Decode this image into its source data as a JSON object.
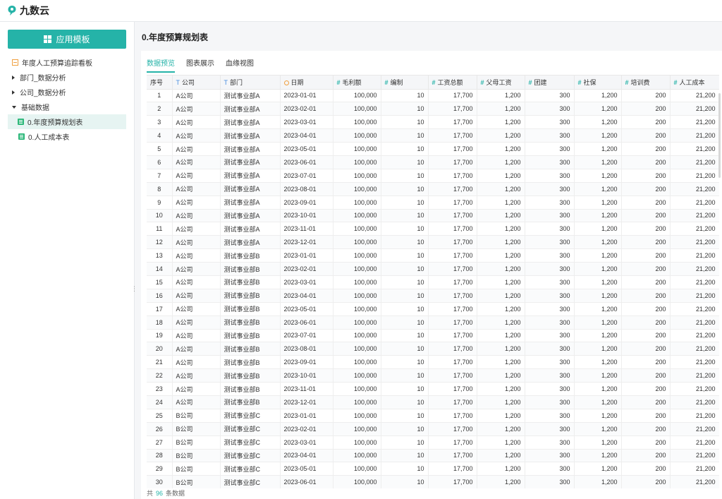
{
  "app": {
    "name": "九数云",
    "logo_icon": "jiushuyun-logo-icon"
  },
  "sidebar": {
    "template_button": "应用模板",
    "tree": [
      {
        "label": "年度人工预算追踪看板",
        "icon": "dashboard-icon",
        "level": 0
      },
      {
        "label": "部门_数据分析",
        "icon": "caret-right-icon",
        "level": 0
      },
      {
        "label": "公司_数据分析",
        "icon": "caret-right-icon",
        "level": 0
      },
      {
        "label": "基础数据",
        "icon": "caret-down-icon",
        "level": 0
      },
      {
        "label": "0.年度预算规划表",
        "icon": "table-icon",
        "level": 1,
        "selected": true
      },
      {
        "label": "0.人工成本表",
        "icon": "table-icon",
        "level": 1
      }
    ]
  },
  "main": {
    "title": "0.年度预算规划表",
    "tabs": [
      "数据预览",
      "图表展示",
      "血缘视图"
    ],
    "active_tab": 0
  },
  "table": {
    "columns": [
      {
        "label": "序号",
        "type": "index"
      },
      {
        "label": "公司",
        "type": "text"
      },
      {
        "label": "部门",
        "type": "text"
      },
      {
        "label": "日期",
        "type": "date"
      },
      {
        "label": "毛利额",
        "type": "number"
      },
      {
        "label": "编制",
        "type": "number"
      },
      {
        "label": "工资总额",
        "type": "number"
      },
      {
        "label": "父母工资",
        "type": "number"
      },
      {
        "label": "团建",
        "type": "number"
      },
      {
        "label": "社保",
        "type": "number"
      },
      {
        "label": "培训费",
        "type": "number"
      },
      {
        "label": "人工成本",
        "type": "number"
      }
    ],
    "rows": [
      [
        "1",
        "A公司",
        "测试事业部A",
        "2023-01-01",
        "100,000",
        "10",
        "17,700",
        "1,200",
        "300",
        "1,200",
        "200",
        "21,200"
      ],
      [
        "2",
        "A公司",
        "测试事业部A",
        "2023-02-01",
        "100,000",
        "10",
        "17,700",
        "1,200",
        "300",
        "1,200",
        "200",
        "21,200"
      ],
      [
        "3",
        "A公司",
        "测试事业部A",
        "2023-03-01",
        "100,000",
        "10",
        "17,700",
        "1,200",
        "300",
        "1,200",
        "200",
        "21,200"
      ],
      [
        "4",
        "A公司",
        "测试事业部A",
        "2023-04-01",
        "100,000",
        "10",
        "17,700",
        "1,200",
        "300",
        "1,200",
        "200",
        "21,200"
      ],
      [
        "5",
        "A公司",
        "测试事业部A",
        "2023-05-01",
        "100,000",
        "10",
        "17,700",
        "1,200",
        "300",
        "1,200",
        "200",
        "21,200"
      ],
      [
        "6",
        "A公司",
        "测试事业部A",
        "2023-06-01",
        "100,000",
        "10",
        "17,700",
        "1,200",
        "300",
        "1,200",
        "200",
        "21,200"
      ],
      [
        "7",
        "A公司",
        "测试事业部A",
        "2023-07-01",
        "100,000",
        "10",
        "17,700",
        "1,200",
        "300",
        "1,200",
        "200",
        "21,200"
      ],
      [
        "8",
        "A公司",
        "测试事业部A",
        "2023-08-01",
        "100,000",
        "10",
        "17,700",
        "1,200",
        "300",
        "1,200",
        "200",
        "21,200"
      ],
      [
        "9",
        "A公司",
        "测试事业部A",
        "2023-09-01",
        "100,000",
        "10",
        "17,700",
        "1,200",
        "300",
        "1,200",
        "200",
        "21,200"
      ],
      [
        "10",
        "A公司",
        "测试事业部A",
        "2023-10-01",
        "100,000",
        "10",
        "17,700",
        "1,200",
        "300",
        "1,200",
        "200",
        "21,200"
      ],
      [
        "11",
        "A公司",
        "测试事业部A",
        "2023-11-01",
        "100,000",
        "10",
        "17,700",
        "1,200",
        "300",
        "1,200",
        "200",
        "21,200"
      ],
      [
        "12",
        "A公司",
        "测试事业部A",
        "2023-12-01",
        "100,000",
        "10",
        "17,700",
        "1,200",
        "300",
        "1,200",
        "200",
        "21,200"
      ],
      [
        "13",
        "A公司",
        "测试事业部B",
        "2023-01-01",
        "100,000",
        "10",
        "17,700",
        "1,200",
        "300",
        "1,200",
        "200",
        "21,200"
      ],
      [
        "14",
        "A公司",
        "测试事业部B",
        "2023-02-01",
        "100,000",
        "10",
        "17,700",
        "1,200",
        "300",
        "1,200",
        "200",
        "21,200"
      ],
      [
        "15",
        "A公司",
        "测试事业部B",
        "2023-03-01",
        "100,000",
        "10",
        "17,700",
        "1,200",
        "300",
        "1,200",
        "200",
        "21,200"
      ],
      [
        "16",
        "A公司",
        "测试事业部B",
        "2023-04-01",
        "100,000",
        "10",
        "17,700",
        "1,200",
        "300",
        "1,200",
        "200",
        "21,200"
      ],
      [
        "17",
        "A公司",
        "测试事业部B",
        "2023-05-01",
        "100,000",
        "10",
        "17,700",
        "1,200",
        "300",
        "1,200",
        "200",
        "21,200"
      ],
      [
        "18",
        "A公司",
        "测试事业部B",
        "2023-06-01",
        "100,000",
        "10",
        "17,700",
        "1,200",
        "300",
        "1,200",
        "200",
        "21,200"
      ],
      [
        "19",
        "A公司",
        "测试事业部B",
        "2023-07-01",
        "100,000",
        "10",
        "17,700",
        "1,200",
        "300",
        "1,200",
        "200",
        "21,200"
      ],
      [
        "20",
        "A公司",
        "测试事业部B",
        "2023-08-01",
        "100,000",
        "10",
        "17,700",
        "1,200",
        "300",
        "1,200",
        "200",
        "21,200"
      ],
      [
        "21",
        "A公司",
        "测试事业部B",
        "2023-09-01",
        "100,000",
        "10",
        "17,700",
        "1,200",
        "300",
        "1,200",
        "200",
        "21,200"
      ],
      [
        "22",
        "A公司",
        "测试事业部B",
        "2023-10-01",
        "100,000",
        "10",
        "17,700",
        "1,200",
        "300",
        "1,200",
        "200",
        "21,200"
      ],
      [
        "23",
        "A公司",
        "测试事业部B",
        "2023-11-01",
        "100,000",
        "10",
        "17,700",
        "1,200",
        "300",
        "1,200",
        "200",
        "21,200"
      ],
      [
        "24",
        "A公司",
        "测试事业部B",
        "2023-12-01",
        "100,000",
        "10",
        "17,700",
        "1,200",
        "300",
        "1,200",
        "200",
        "21,200"
      ],
      [
        "25",
        "B公司",
        "测试事业部C",
        "2023-01-01",
        "100,000",
        "10",
        "17,700",
        "1,200",
        "300",
        "1,200",
        "200",
        "21,200"
      ],
      [
        "26",
        "B公司",
        "测试事业部C",
        "2023-02-01",
        "100,000",
        "10",
        "17,700",
        "1,200",
        "300",
        "1,200",
        "200",
        "21,200"
      ],
      [
        "27",
        "B公司",
        "测试事业部C",
        "2023-03-01",
        "100,000",
        "10",
        "17,700",
        "1,200",
        "300",
        "1,200",
        "200",
        "21,200"
      ],
      [
        "28",
        "B公司",
        "测试事业部C",
        "2023-04-01",
        "100,000",
        "10",
        "17,700",
        "1,200",
        "300",
        "1,200",
        "200",
        "21,200"
      ],
      [
        "29",
        "B公司",
        "测试事业部C",
        "2023-05-01",
        "100,000",
        "10",
        "17,700",
        "1,200",
        "300",
        "1,200",
        "200",
        "21,200"
      ],
      [
        "30",
        "B公司",
        "测试事业部C",
        "2023-06-01",
        "100,000",
        "10",
        "17,700",
        "1,200",
        "300",
        "1,200",
        "200",
        "21,200"
      ]
    ]
  },
  "footer": {
    "prefix": "共",
    "count": "96",
    "suffix": "条数据"
  },
  "colors": {
    "accent": "#25b3a8",
    "text_type": "#4a8fe0",
    "date_type": "#f0a040",
    "table_icon": "#2eb87a"
  }
}
